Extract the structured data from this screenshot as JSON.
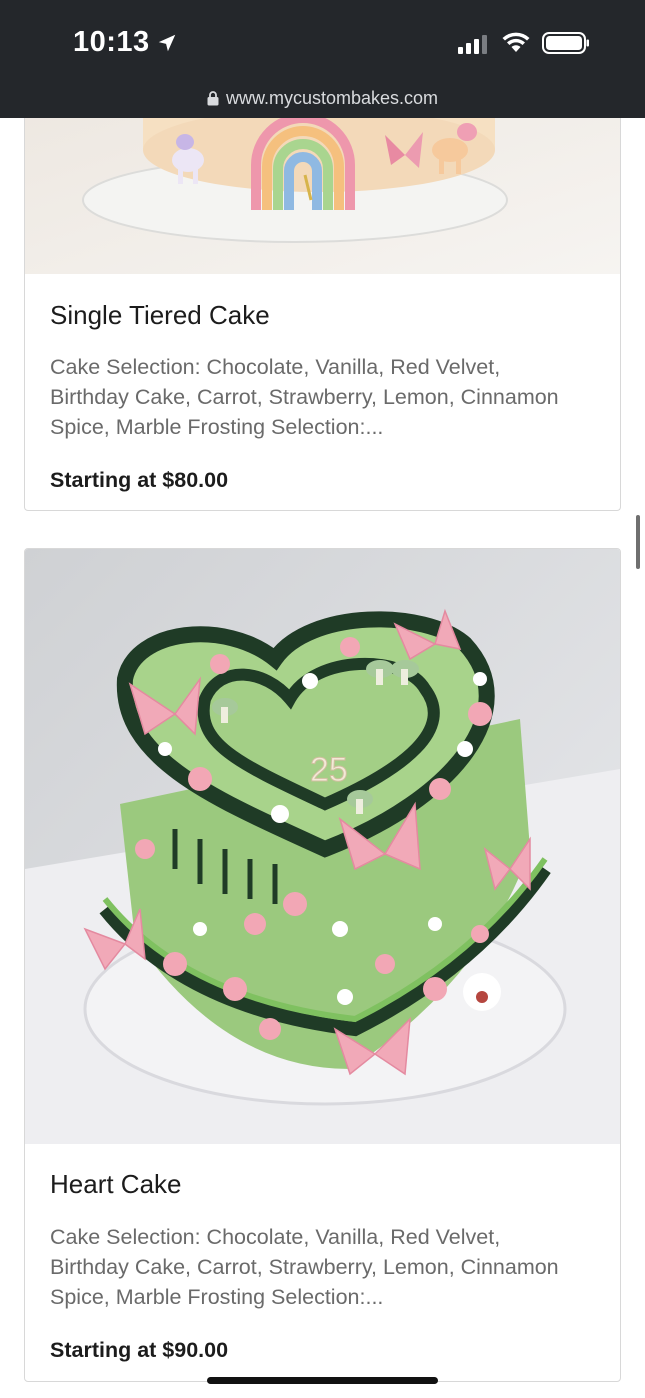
{
  "status_bar": {
    "time": "10:13",
    "url": "www.mycustombakes.com"
  },
  "products": [
    {
      "title": "Single Tiered Cake",
      "description": "Cake Selection: Chocolate, Vanilla, Red Velvet, Birthday Cake, Carrot, Strawberry, Lemon, Cinnamon Spice, Marble Frosting Selection:...",
      "price": "Starting at $80.00"
    },
    {
      "title": "Heart Cake",
      "description": "Cake Selection: Chocolate, Vanilla, Red Velvet, Birthday Cake, Carrot, Strawberry, Lemon, Cinnamon Spice, Marble Frosting Selection:...",
      "price": "Starting at $90.00",
      "cake_topper": "25"
    }
  ],
  "colors": {
    "topbar": "#24272b",
    "cake_green": "#9bc97e",
    "frosting_dark_green": "#1f3b26",
    "pink_accent": "#f1a9b8"
  }
}
